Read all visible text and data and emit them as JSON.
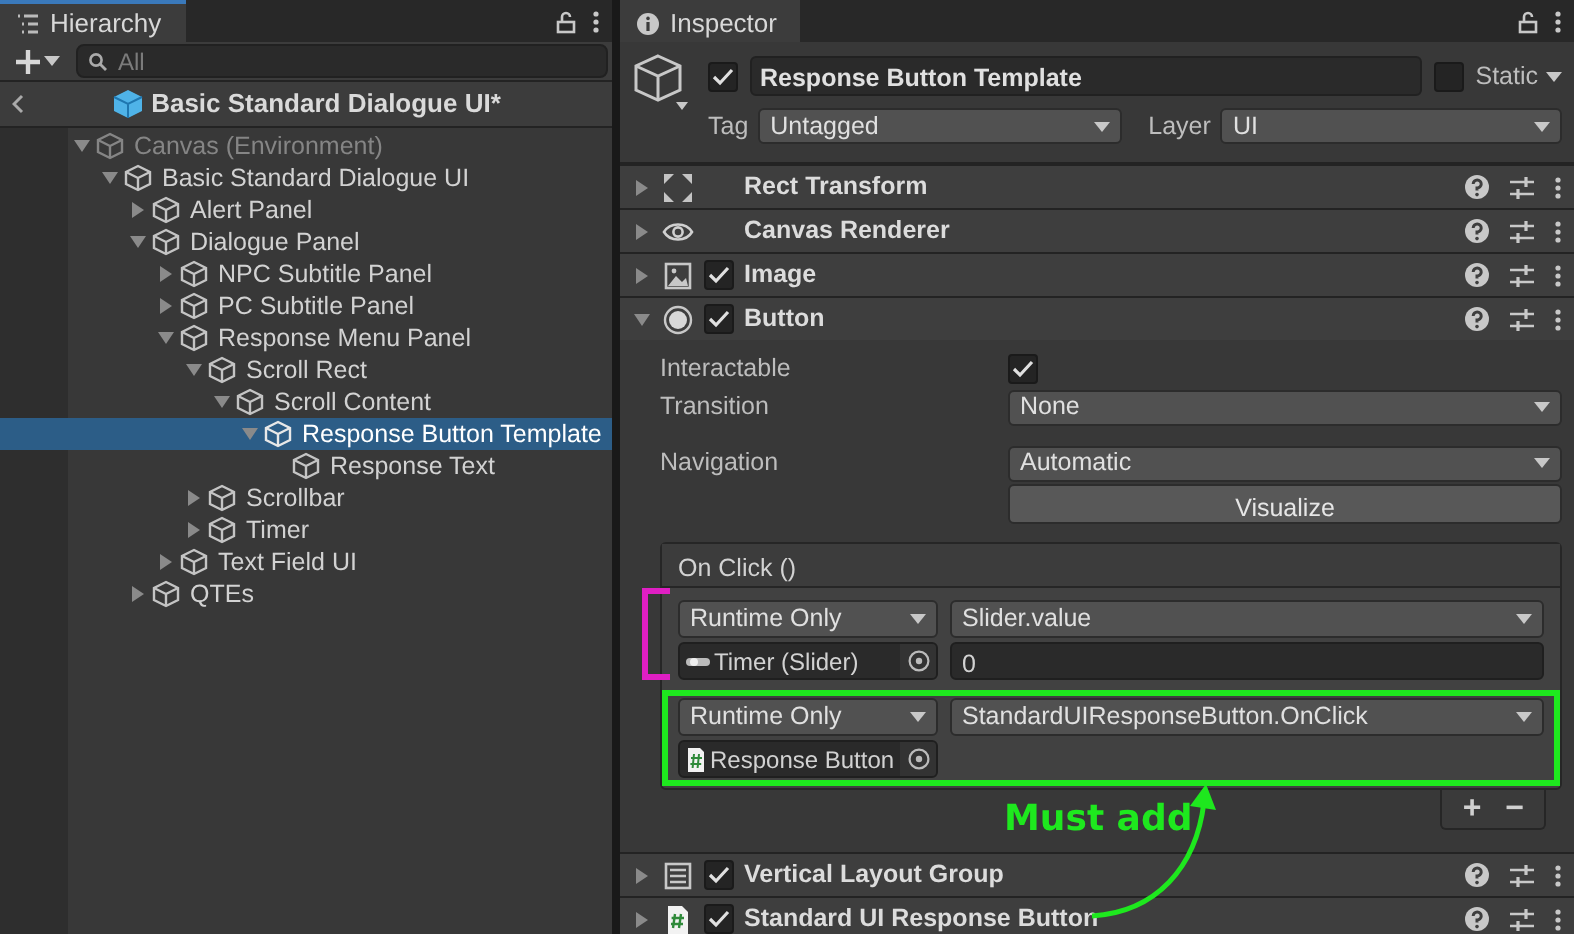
{
  "hierarchy": {
    "title": "Hierarchy",
    "search": {
      "placeholder": "All"
    },
    "scene": "Basic Standard Dialogue UI*",
    "tree": [
      {
        "label": "Canvas (Environment)",
        "kind": "group",
        "expanded": true,
        "selected": false,
        "dimmed": true,
        "children": [
          {
            "label": "Basic Standard Dialogue UI",
            "kind": "group",
            "expanded": true,
            "selected": false,
            "children": [
              {
                "label": "Alert Panel",
                "kind": "group",
                "expanded": false,
                "selected": false
              },
              {
                "label": "Dialogue Panel",
                "kind": "group",
                "expanded": true,
                "selected": false,
                "children": [
                  {
                    "label": "NPC Subtitle Panel",
                    "kind": "group",
                    "expanded": false,
                    "selected": false
                  },
                  {
                    "label": "PC Subtitle Panel",
                    "kind": "group",
                    "expanded": false,
                    "selected": false
                  },
                  {
                    "label": "Response Menu Panel",
                    "kind": "group",
                    "expanded": true,
                    "selected": false,
                    "children": [
                      {
                        "label": "Scroll Rect",
                        "kind": "group",
                        "expanded": true,
                        "selected": false,
                        "children": [
                          {
                            "label": "Scroll Content",
                            "kind": "group",
                            "expanded": true,
                            "selected": false,
                            "children": [
                              {
                                "label": "Response Button Template",
                                "kind": "group",
                                "expanded": true,
                                "selected": true,
                                "children": [
                                  {
                                    "label": "Response Text",
                                    "kind": "leaf",
                                    "selected": false
                                  }
                                ]
                              }
                            ]
                          }
                        ]
                      },
                      {
                        "label": "Scrollbar",
                        "kind": "group",
                        "expanded": false,
                        "selected": false
                      },
                      {
                        "label": "Timer",
                        "kind": "group",
                        "expanded": false,
                        "selected": false
                      }
                    ]
                  },
                  {
                    "label": "Text Field UI",
                    "kind": "group",
                    "expanded": false,
                    "selected": false
                  }
                ]
              },
              {
                "label": "QTEs",
                "kind": "group",
                "expanded": false,
                "selected": false
              }
            ]
          }
        ]
      }
    ]
  },
  "inspector": {
    "title": "Inspector",
    "object": {
      "active": true,
      "name": "Response Button Template",
      "static": false,
      "static_label": "Static",
      "tag_label": "Tag",
      "tag": "Untagged",
      "layer_label": "Layer",
      "layer": "UI"
    },
    "components": [
      {
        "name": "Rect Transform",
        "kind": "transform",
        "expanded": false
      },
      {
        "name": "Canvas Renderer",
        "kind": "renderer",
        "expanded": false
      },
      {
        "name": "Image",
        "kind": "image",
        "enabled": true,
        "expanded": false
      },
      {
        "name": "Button",
        "kind": "button",
        "enabled": true,
        "expanded": true,
        "properties": [
          {
            "label": "Interactable",
            "kind": "checkbox",
            "checked": true
          },
          {
            "label": "Transition",
            "kind": "dropdown",
            "value": "None"
          },
          {
            "label": "Navigation",
            "kind": "dropdown",
            "value": "Automatic"
          }
        ],
        "visualize": "Visualize",
        "event": {
          "title": "On Click ()",
          "entries": [
            {
              "mode": "Runtime Only",
              "function": "Slider.value",
              "target": {
                "label": "Timer (Slider)",
                "kind": "slider"
              },
              "argument": "0",
              "kind": "bracket",
              "color": "#e01fc4"
            },
            {
              "mode": "Runtime Only",
              "function": "StandardUIResponseButton.OnClick",
              "target": {
                "label": "Response Button",
                "kind": "script"
              },
              "kind": "box",
              "color": "#1ee81e"
            }
          ],
          "add": "+",
          "remove": "−"
        }
      },
      {
        "name": "Vertical Layout Group",
        "kind": "layout",
        "enabled": true,
        "expanded": false
      },
      {
        "name": "Standard UI Response Button",
        "kind": "script",
        "enabled": true,
        "expanded": false
      }
    ],
    "callout": {
      "text": "Must add",
      "color": "#1ee81e"
    }
  }
}
